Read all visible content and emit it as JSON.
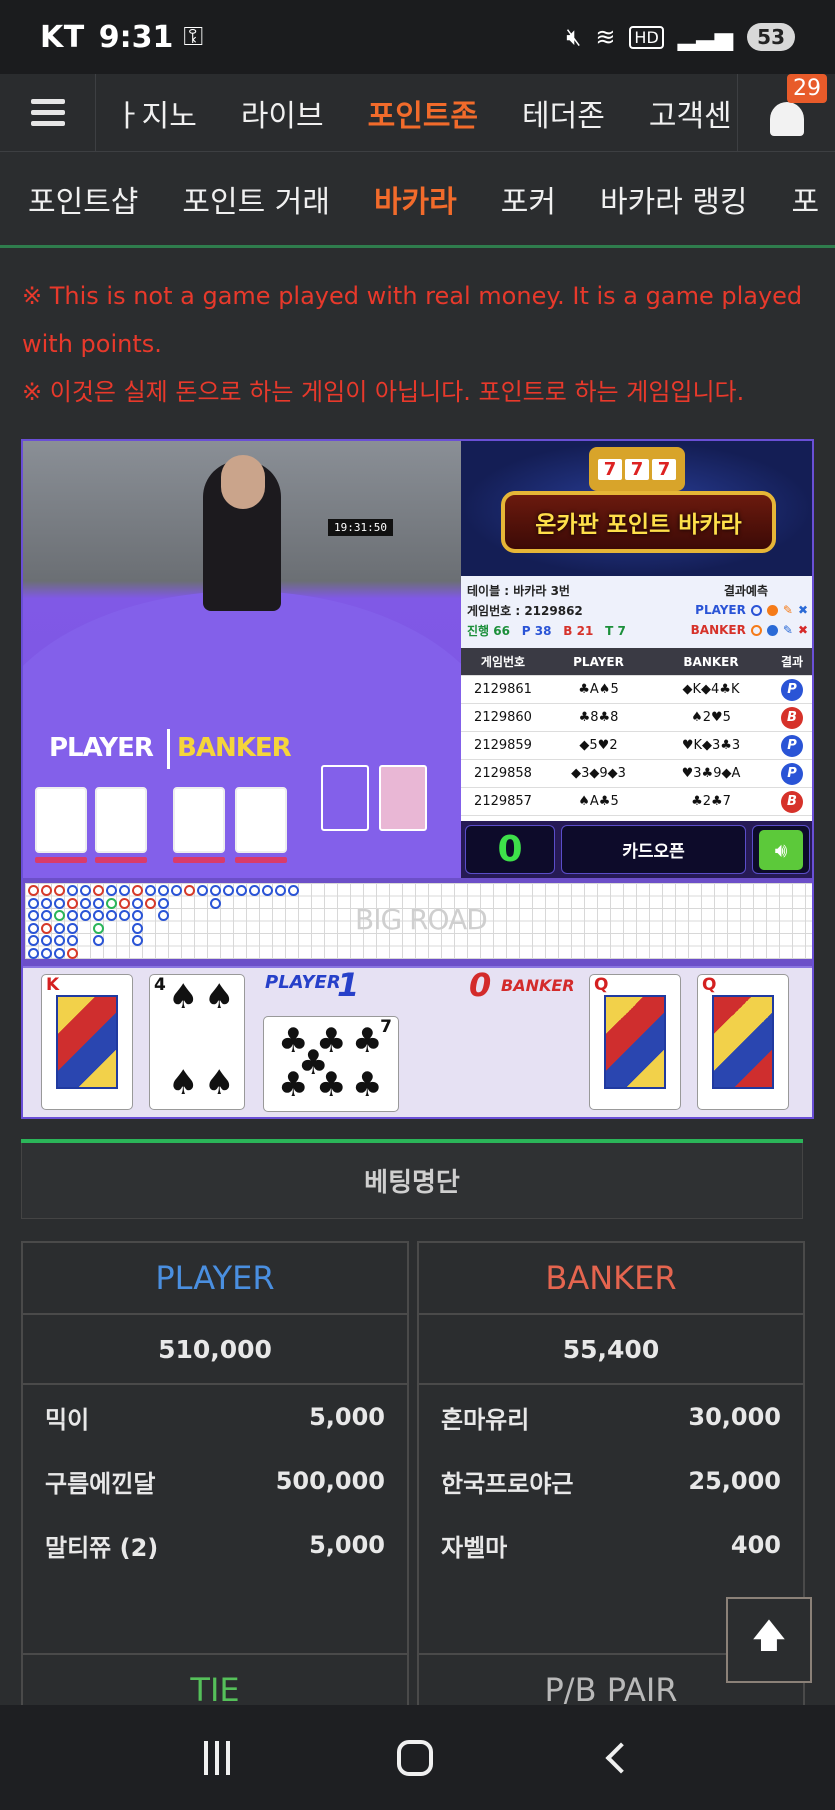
{
  "status_bar": {
    "carrier": "KT",
    "time": "9:31",
    "battery": "53"
  },
  "top_nav": {
    "items": [
      "ㅏ지노",
      "라이브",
      "포인트존",
      "테더존",
      "고객센"
    ],
    "active_index": 2,
    "notification_count": "29"
  },
  "sub_nav": {
    "items": [
      "포인트샵",
      "포인트 거래",
      "바카라",
      "포커",
      "바카라 랭킹",
      "포"
    ],
    "active_index": 2
  },
  "notice": {
    "line_en": "※ This is not a game played with real money. It is a game played with points.",
    "line_ko": "※ 이것은 실제 돈으로 하는 게임이 아닙니다. 포인트로 하는 게임입니다."
  },
  "game": {
    "video": {
      "clock": "19:31:50",
      "player_label": "PLAYER",
      "banker_label": "BANKER",
      "table_player": "PLAYER",
      "table_banker": "BANKER"
    },
    "promo_title": "온카판 포인트 바카라",
    "slot_digits": [
      "7",
      "7",
      "7"
    ],
    "info": {
      "table": "테이블 : 바카라 3번",
      "game_number": "게임번호 : 2129862",
      "prediction_label": "결과예측",
      "player": "PLAYER",
      "banker": "BANKER",
      "progress_label": "진행 66",
      "p_count": "P 38",
      "b_count": "B 21",
      "t_count": "T 7"
    },
    "history": {
      "headers": [
        "게임번호",
        "PLAYER",
        "BANKER",
        "결과"
      ],
      "rows": [
        {
          "id": "2129861",
          "player": "♣A♠5",
          "banker": "◆K◆4♣K",
          "result": "P"
        },
        {
          "id": "2129860",
          "player": "♣8♣8",
          "banker": "♠2♥5",
          "result": "B"
        },
        {
          "id": "2129859",
          "player": "◆5♥2",
          "banker": "♥K◆3♣3",
          "result": "P"
        },
        {
          "id": "2129858",
          "player": "◆3◆9◆3",
          "banker": "♥3♣9◆A",
          "result": "P"
        },
        {
          "id": "2129857",
          "player": "♠A♣5",
          "banker": "♣2♣7",
          "result": "B"
        }
      ]
    },
    "counter": "0",
    "card_open_label": "카드오픈",
    "big_road_label": "BIG ROAD",
    "reveal": {
      "player_label": "PLAYER",
      "player_score": "1",
      "banker_label": "BANKER",
      "banker_score": "0",
      "player_cards": [
        {
          "rank": "K",
          "suit": "♥"
        },
        {
          "rank": "4",
          "suit": "♠"
        },
        {
          "rank": "7",
          "suit": "♣"
        }
      ],
      "banker_cards": [
        {
          "rank": "Q",
          "suit": "♥"
        },
        {
          "rank": "Q",
          "suit": "♦"
        }
      ]
    }
  },
  "betting": {
    "title": "베팅명단",
    "player": {
      "label": "PLAYER",
      "total": "510,000",
      "entries": [
        {
          "name": "믹이",
          "amount": "5,000"
        },
        {
          "name": "구름에낀달",
          "amount": "500,000"
        },
        {
          "name": "말티쮸 (2)",
          "amount": "5,000"
        }
      ]
    },
    "banker": {
      "label": "BANKER",
      "total": "55,400",
      "entries": [
        {
          "name": "혼마유리",
          "amount": "30,000"
        },
        {
          "name": "한국프로야근",
          "amount": "25,000"
        },
        {
          "name": "자벨마",
          "amount": "400"
        }
      ]
    },
    "tie_label": "TIE",
    "pair_label": "P/B PAIR"
  },
  "icons": {
    "menu": "hamburger-icon",
    "bell": "bell-icon",
    "sound": "speaker-icon",
    "scroll_top": "arrow-up-icon"
  }
}
